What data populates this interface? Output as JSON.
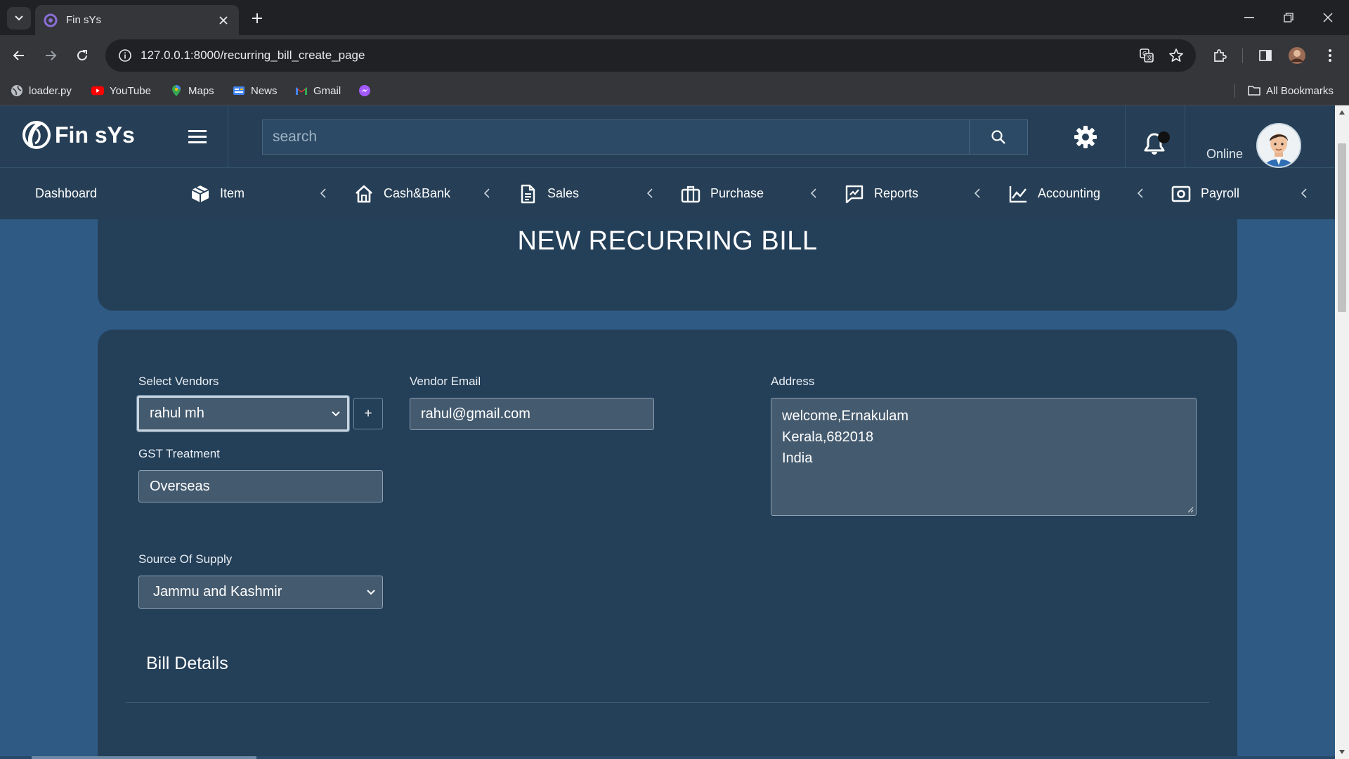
{
  "browser": {
    "tab_title": "Fin sYs",
    "url": "127.0.0.1:8000/recurring_bill_create_page",
    "bookmarks": [
      "loader.py",
      "YouTube",
      "Maps",
      "News",
      "Gmail"
    ],
    "all_bookmarks_label": "All Bookmarks"
  },
  "app": {
    "brand": "Fin sYs",
    "search_placeholder": "search",
    "status": "Online",
    "accent_color": "#263f56"
  },
  "nav": {
    "dashboard": "Dashboard",
    "items": [
      {
        "label": "Item",
        "icon": "box-icon"
      },
      {
        "label": "Cash&Bank",
        "icon": "home-icon"
      },
      {
        "label": "Sales",
        "icon": "document-icon"
      },
      {
        "label": "Purchase",
        "icon": "briefcase-icon"
      },
      {
        "label": "Reports",
        "icon": "report-icon"
      },
      {
        "label": "Accounting",
        "icon": "chart-line-icon"
      },
      {
        "label": "Payroll",
        "icon": "money-icon"
      }
    ]
  },
  "page": {
    "heading": "NEW RECURRING BILL"
  },
  "form": {
    "vendor_label": "Select Vendors",
    "vendor_value": "rahul mh",
    "add_vendor_label": "+",
    "email_label": "Vendor Email",
    "email_value": "rahul@gmail.com",
    "address_label": "Address",
    "address_lines": [
      "welcome,Ernakulam",
      "Kerala,682018",
      "India"
    ],
    "gst_label": "GST Treatment",
    "gst_value": "Overseas",
    "supply_label": "Source Of Supply",
    "supply_value": "Jammu and Kashmir",
    "bill_details_title": "Bill Details"
  }
}
